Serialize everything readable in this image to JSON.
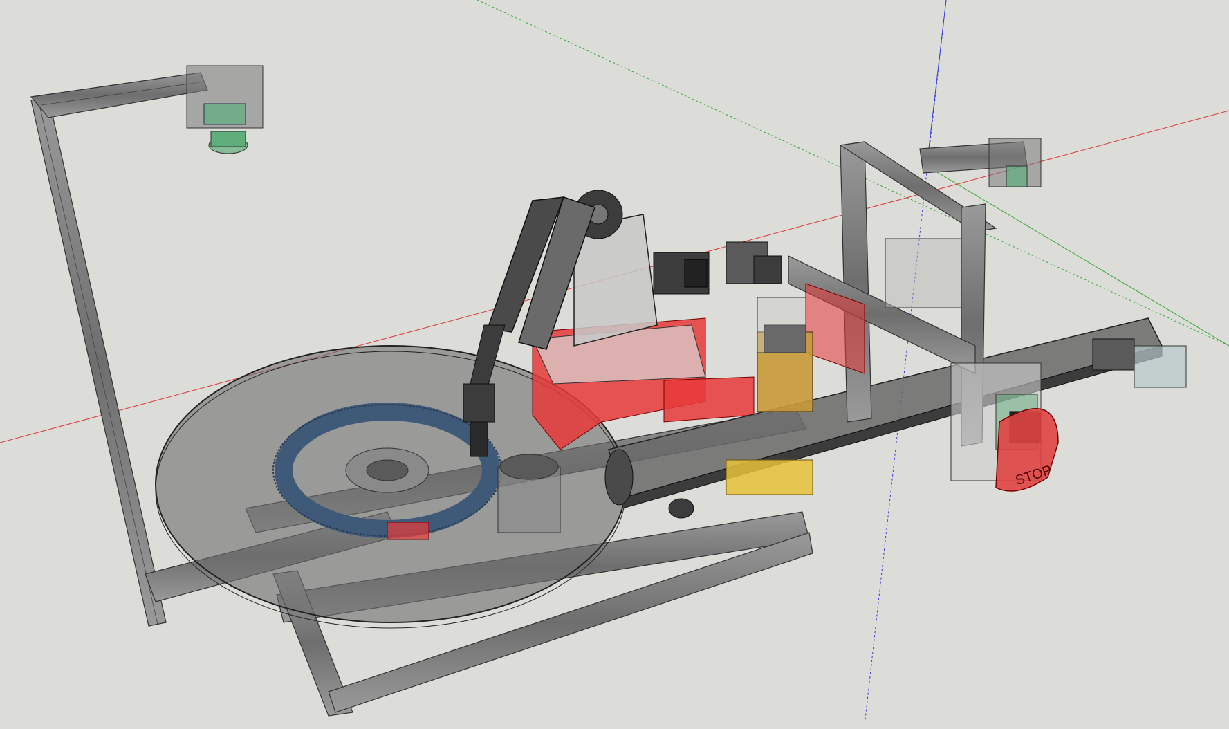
{
  "viewport": {
    "background": "#dcdcd8",
    "axis_colors": {
      "red": "#d93a3a",
      "green": "#3aa63a",
      "blue": "#3a3ad9"
    }
  },
  "colors": {
    "extrusion": "#8a8a8a",
    "extrusion_dark": "#3c3c3c",
    "turntable": "#6e6e6e",
    "gear": "#3f5a78",
    "red_part": "#e83a3a",
    "camera_green": "#5fae7c",
    "yellow_part": "#e6c23a",
    "stop_red": "#e04444"
  },
  "icons": {
    "stop_button": "emergency-stop-icon",
    "camera": "camera-icon",
    "stepper": "stepper-motor-icon"
  },
  "labels": {
    "stop": "STOP"
  }
}
